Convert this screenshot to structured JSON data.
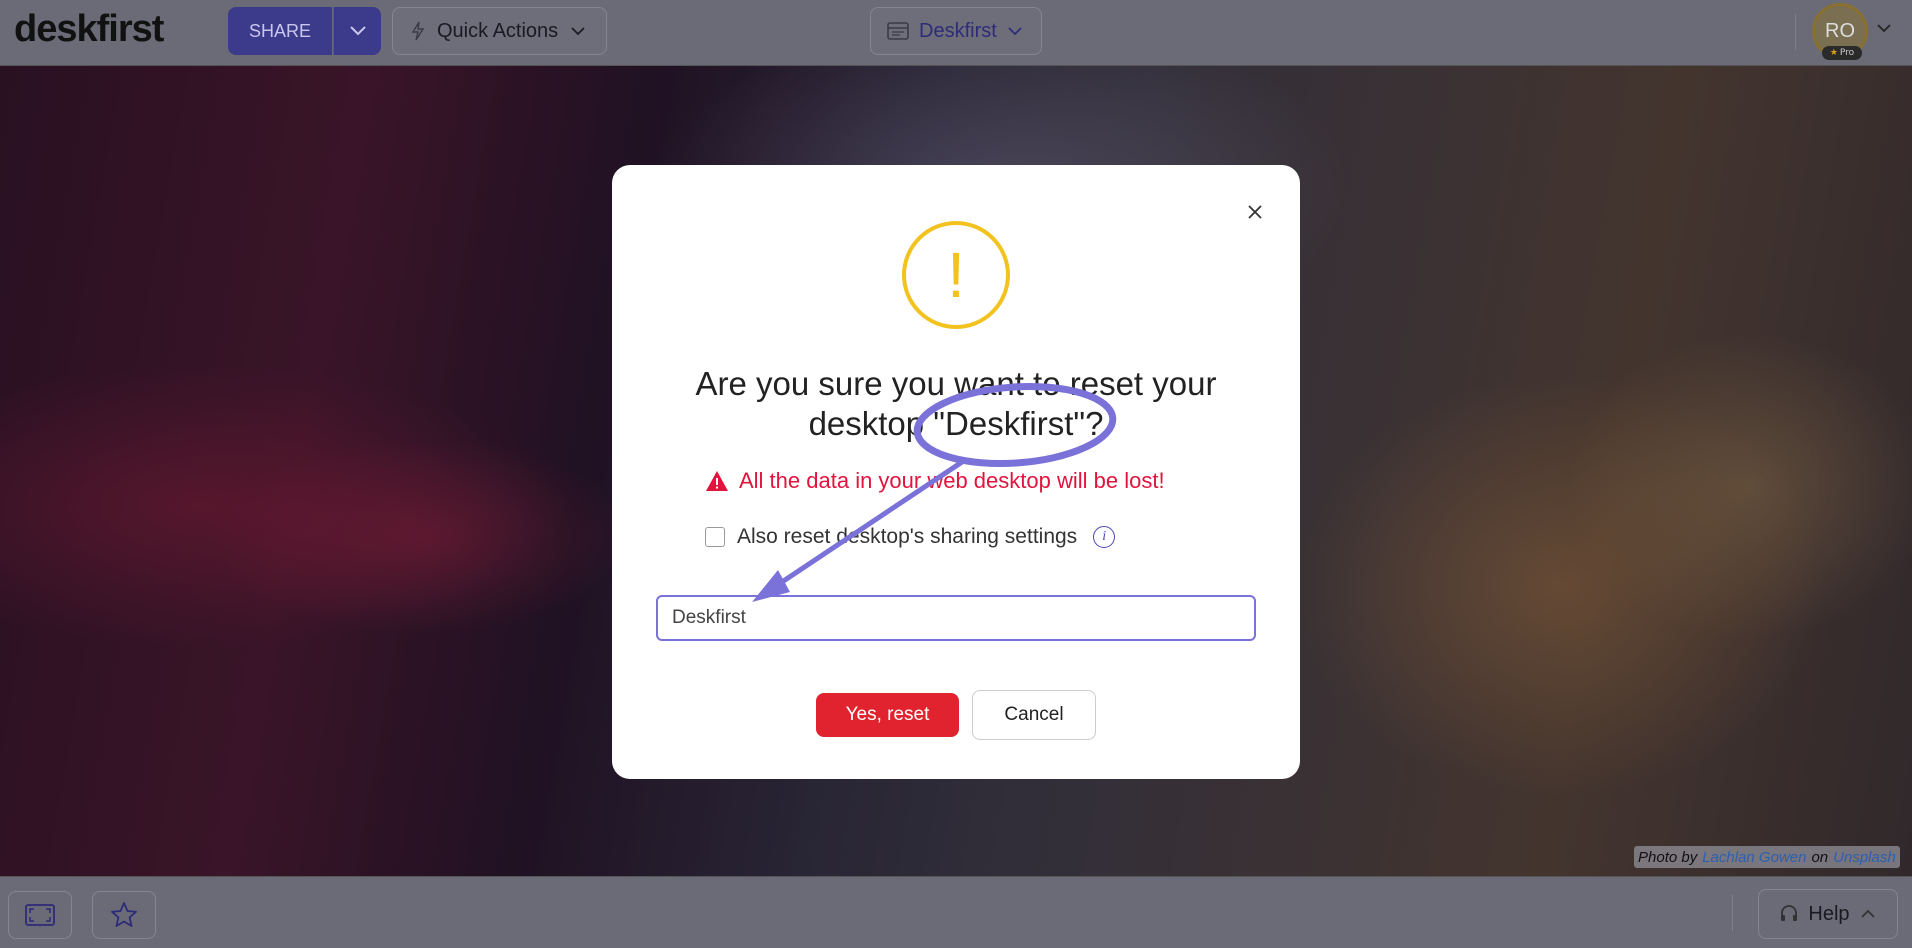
{
  "topbar": {
    "logo": "deskfirst",
    "share_label": "SHARE",
    "quick_actions_label": "Quick Actions",
    "desktop_label": "Deskfirst",
    "avatar_initials": "RO",
    "pro_badge": "Pro"
  },
  "modal": {
    "title_line1": "Are you sure you want to reset your",
    "title_line2": "desktop \"Deskfirst\"?",
    "warning": "All the data in your web desktop will be lost!",
    "checkbox_label": "Also reset desktop's sharing settings",
    "checkbox_checked": false,
    "input_value": "Deskfirst",
    "confirm_label": "Yes, reset",
    "cancel_label": "Cancel"
  },
  "bottombar": {
    "help_label": "Help"
  },
  "credit": {
    "prefix": "Photo by",
    "author": "Lachlan Gowen",
    "on": "on",
    "site": "Unsplash"
  },
  "colors": {
    "brand": "#3c3a8a",
    "danger": "#e0232f",
    "warning": "#f2c21e",
    "annotation": "#7b72d9"
  }
}
